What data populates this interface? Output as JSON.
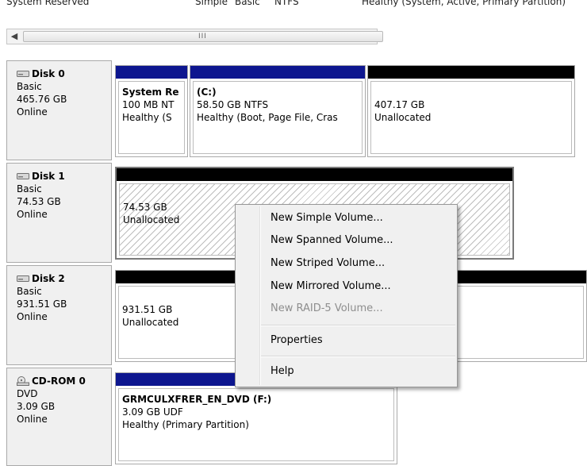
{
  "top_row": {
    "name": "System Reserved",
    "layout": "Simple",
    "type": "Basic",
    "fs": "NTFS",
    "status": "Healthy (System, Active, Primary Partition)"
  },
  "scrollbar": {
    "left_arrow": "◀",
    "grip": "III"
  },
  "disks": [
    {
      "title": "Disk 0",
      "type": "Basic",
      "size": "465.76 GB",
      "state": "Online",
      "partitions": [
        {
          "name": "System Re",
          "detail": "100 MB NT",
          "status": "Healthy (S"
        },
        {
          "name": "(C:)",
          "detail": "58.50 GB NTFS",
          "status": "Healthy (Boot, Page File, Cras"
        },
        {
          "name": "",
          "detail": "407.17 GB",
          "status": "Unallocated"
        }
      ]
    },
    {
      "title": "Disk 1",
      "type": "Basic",
      "size": "74.53 GB",
      "state": "Online",
      "partitions": [
        {
          "name": "",
          "detail": "74.53 GB",
          "status": "Unallocated"
        }
      ]
    },
    {
      "title": "Disk 2",
      "type": "Basic",
      "size": "931.51 GB",
      "state": "Online",
      "partitions": [
        {
          "name": "",
          "detail": "931.51 GB",
          "status": "Unallocated"
        }
      ]
    },
    {
      "title": "CD-ROM 0",
      "type": "DVD",
      "size": "3.09 GB",
      "state": "Online",
      "partitions": [
        {
          "name": "GRMCULXFRER_EN_DVD (F:)",
          "detail": "3.09 GB UDF",
          "status": "Healthy (Primary Partition)"
        }
      ]
    }
  ],
  "context_menu": {
    "items": [
      {
        "label": "New Simple Volume...",
        "enabled": true
      },
      {
        "label": "New Spanned Volume...",
        "enabled": true
      },
      {
        "label": "New Striped Volume...",
        "enabled": true
      },
      {
        "label": "New Mirrored Volume...",
        "enabled": true
      },
      {
        "label": "New RAID-5 Volume...",
        "enabled": false
      },
      {
        "label": "Properties",
        "enabled": true
      },
      {
        "label": "Help",
        "enabled": true
      }
    ]
  },
  "colors": {
    "primary_partition": "#0d168f",
    "unallocated": "#000000",
    "menu_bg": "#f0f0f0"
  }
}
